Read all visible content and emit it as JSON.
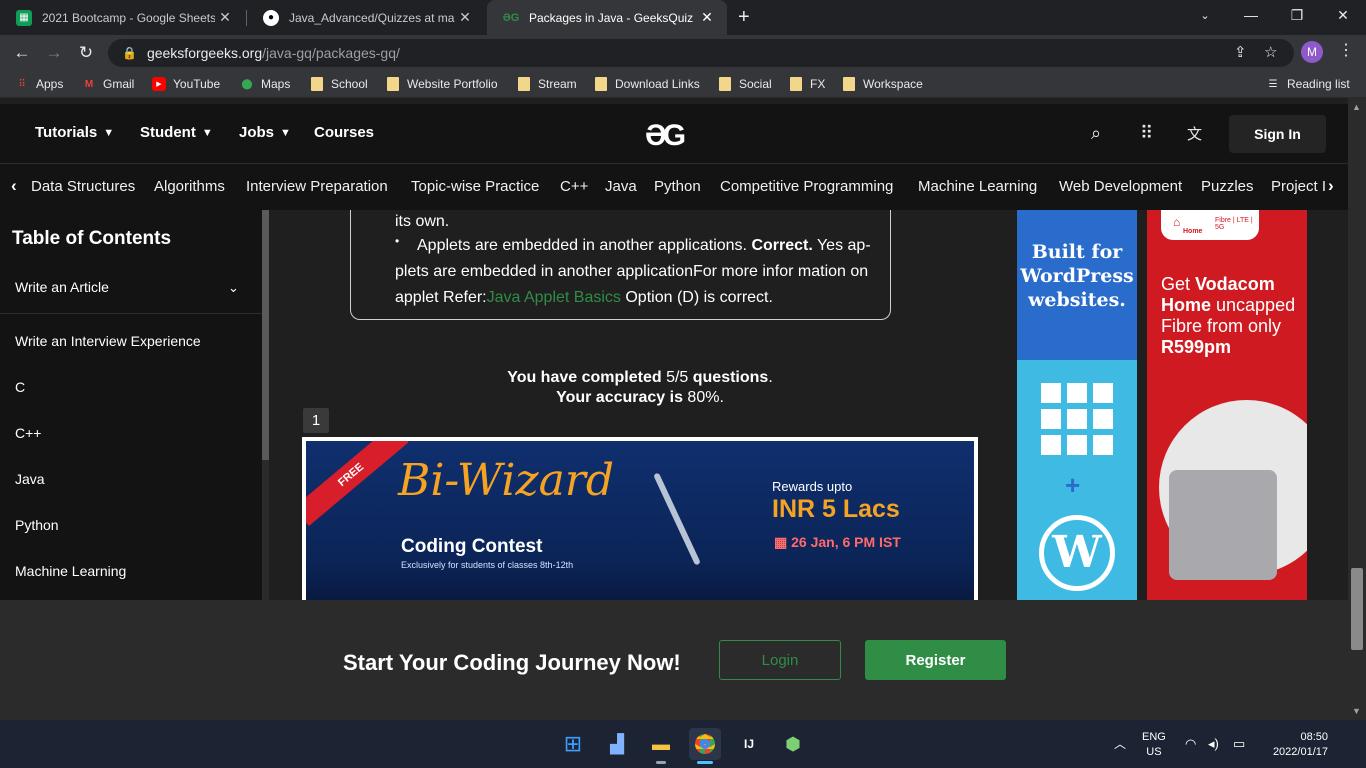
{
  "browser": {
    "tabs": [
      {
        "title": "2021 Bootcamp - Google Sheets",
        "icon": "sheets-icon",
        "color": "#0f9d58"
      },
      {
        "title": "Java_Advanced/Quizzes at main",
        "icon": "github-icon",
        "color": "#ffffff"
      },
      {
        "title": "Packages in Java - GeeksQuiz",
        "icon": "gfg-icon",
        "color": "#2f8d46"
      }
    ],
    "new_tab": "+",
    "url_host": "geeksforgeeks.org",
    "url_path": "/java-gq/packages-gq/",
    "profile_initial": "M",
    "bookmarks": [
      "Apps",
      "Gmail",
      "YouTube",
      "Maps",
      "School",
      "Website Portfolio",
      "Stream",
      "Download Links",
      "Social",
      "FX",
      "Workspace"
    ],
    "reading_list": "Reading list"
  },
  "header": {
    "nav": [
      "Tutorials",
      "Student",
      "Jobs",
      "Courses"
    ],
    "logo": "ƏG",
    "signin": "Sign In"
  },
  "categories": [
    "Data Structures",
    "Algorithms",
    "Interview Preparation",
    "Topic-wise Practice",
    "C++",
    "Java",
    "Python",
    "Competitive Programming",
    "Machine Learning",
    "Web Development",
    "Puzzles",
    "Project I"
  ],
  "sidebar": {
    "title": "Table of Contents",
    "items": [
      "Write an Article",
      "Write an Interview Experience",
      "C",
      "C++",
      "Java",
      "Python",
      "Machine Learning"
    ]
  },
  "content": {
    "line1": "its own.",
    "line2_a": "Applets are embedded in another applications. ",
    "line2_b": "Correct.",
    "line2_c": " Yes ap-",
    "line3": "plets are embedded in another applicationFor more infor mation on",
    "line4_a": "applet Refer:",
    "line4_link": "Java Applet Basics",
    "line4_b": " Option (D) is correct.",
    "result_a": "You have completed ",
    "result_count": "5/5",
    "result_b": " questions",
    "result_c": ".",
    "acc_a": "Your accuracy is ",
    "acc_value": "80%",
    "acc_b": ".",
    "badge": "1"
  },
  "banner": {
    "ribbon": "FREE",
    "title": "Bi-Wizard",
    "subtitle": "Coding Contest",
    "subtitle2": "Exclusively for students of classes 8th-12th",
    "rewards": "Rewards upto",
    "amount": "INR 5 Lacs",
    "date": "26 Jan, 6 PM IST"
  },
  "ads": {
    "wordpress_text": "Built for WordPress websites.",
    "vodacom_chip": "Fibre | LTE | 5G",
    "vodacom_home": "Home",
    "vodacom_pre": "Get ",
    "vodacom_brand": "Vodacom Home",
    "vodacom_mid": " uncapped Fibre from only ",
    "vodacom_price": "R599pm"
  },
  "cta": {
    "text": "Start Your Coding Journey Now!",
    "login": "Login",
    "register": "Register"
  },
  "taskbar": {
    "lang1": "ENG",
    "lang2": "US",
    "time": "08:50",
    "date": "2022/01/17"
  }
}
